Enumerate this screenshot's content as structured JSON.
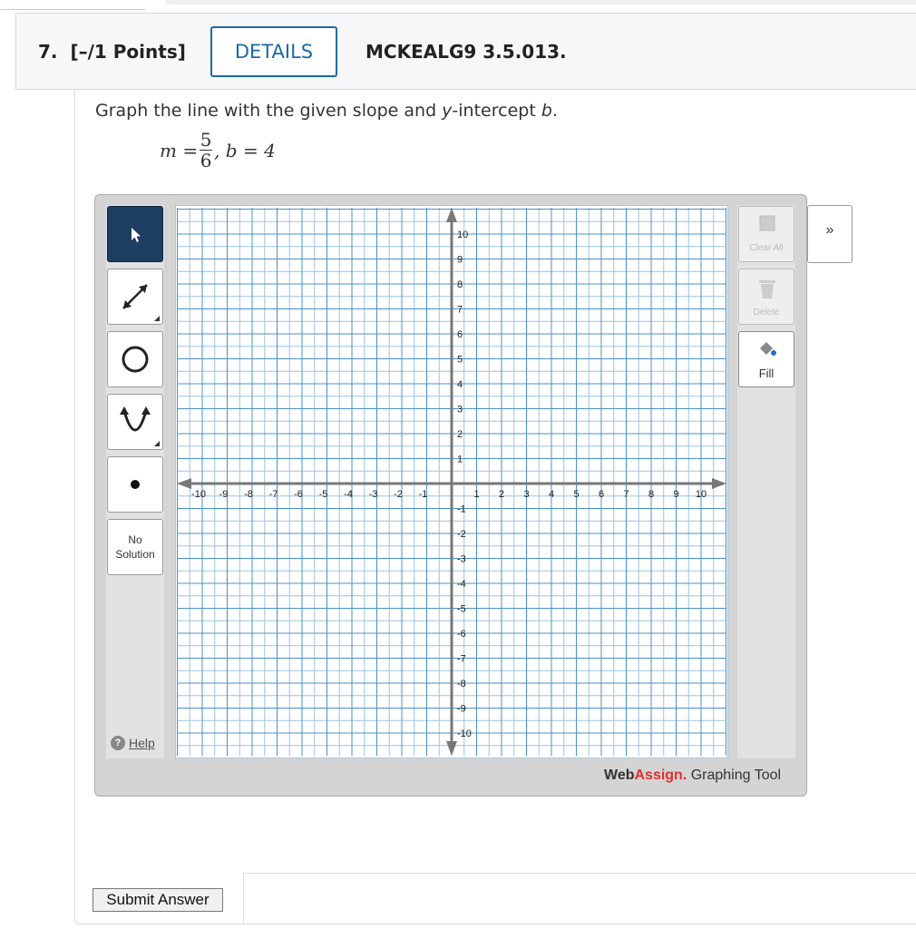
{
  "question": {
    "number": "7.",
    "points": "[–/1 Points]",
    "details_label": "DETAILS",
    "code": "MCKEALG9 3.5.013."
  },
  "prompt": {
    "text_before": "Graph the line with the given slope and ",
    "var_y": "y",
    "text_mid": "-intercept ",
    "var_b": "b",
    "text_end": "."
  },
  "equation": {
    "m_label": "m =",
    "numerator": "5",
    "denominator": "6",
    "b_part": ", b = 4"
  },
  "toolbar": {
    "left_tools": [
      {
        "name": "pointer-tool",
        "icon": "arrow-pointer-icon",
        "active": true
      },
      {
        "name": "line-tool",
        "icon": "line-segment-icon",
        "active": false
      },
      {
        "name": "circle-tool",
        "icon": "circle-icon",
        "active": false
      },
      {
        "name": "parabola-tool",
        "icon": "parabola-icon",
        "active": false
      },
      {
        "name": "point-tool",
        "icon": "point-dot-icon",
        "active": false
      }
    ],
    "no_solution_line1": "No",
    "no_solution_line2": "Solution",
    "clear_all_label": "Clear All",
    "delete_label": "Delete",
    "fill_label": "Fill",
    "expand_label": "»",
    "help_label": "Help"
  },
  "graph": {
    "x_range": [
      -10,
      10
    ],
    "y_range": [
      -10,
      10
    ],
    "x_ticks": [
      "-10",
      "-9",
      "-8",
      "-7",
      "-6",
      "-5",
      "-4",
      "-3",
      "-2",
      "-1",
      "1",
      "2",
      "3",
      "4",
      "5",
      "6",
      "7",
      "8",
      "9",
      "10"
    ],
    "y_ticks": [
      "10",
      "9",
      "8",
      "7",
      "6",
      "5",
      "4",
      "3",
      "2",
      "1",
      "-1",
      "-2",
      "-3",
      "-4",
      "-5",
      "-6",
      "-7",
      "-8",
      "-9",
      "-10"
    ],
    "grid_color": "#4a90c8",
    "grid_minor_color": "#9cc3e3"
  },
  "brand": {
    "web": "Web",
    "assign": "Assign.",
    "tool": " Graphing Tool"
  },
  "submit_label": "Submit Answer"
}
